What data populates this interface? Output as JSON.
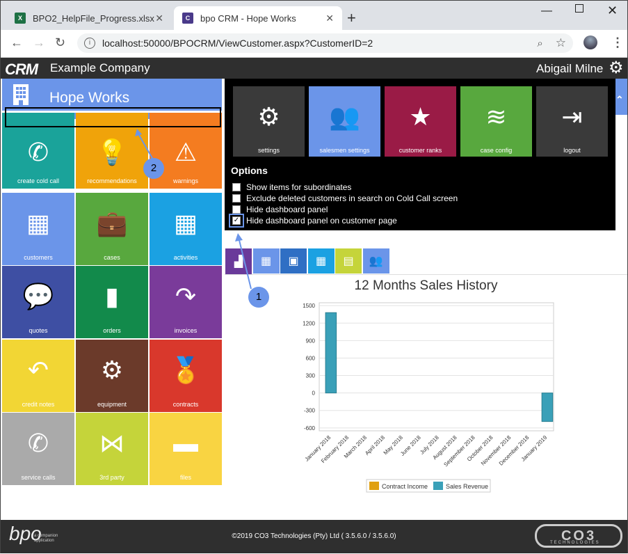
{
  "browser": {
    "tabs": [
      {
        "title": "BPO2_HelpFile_Progress.xlsx",
        "icon": "excel-icon",
        "active": false
      },
      {
        "title": "bpo CRM - Hope Works",
        "icon": "crm-icon",
        "active": true
      }
    ],
    "url_host": "localhost:50000/BPOCRM/ViewCustomer.aspx?CustomerID=2",
    "url_path": ""
  },
  "app": {
    "logo": "CRM",
    "company": "Example Company",
    "user": "Abigail Milne"
  },
  "customer": {
    "name": "Hope Works"
  },
  "tiles": [
    {
      "label": "create cold call",
      "icon": "phone-icon",
      "color": "#1aa39a"
    },
    {
      "label": "recommendations",
      "icon": "lightbulb-icon",
      "color": "#f0a30a"
    },
    {
      "label": "warnings",
      "icon": "warning-icon",
      "color": "#f47c20"
    },
    {
      "label": "customers",
      "icon": "building-icon",
      "color": "#6b95e9"
    },
    {
      "label": "cases",
      "icon": "briefcase-icon",
      "color": "#58a83e"
    },
    {
      "label": "activities",
      "icon": "calendar-icon",
      "color": "#1ba1e2"
    },
    {
      "label": "quotes",
      "icon": "chat-icon",
      "color": "#3e4fa3"
    },
    {
      "label": "orders",
      "icon": "book-icon",
      "color": "#128a4b"
    },
    {
      "label": "invoices",
      "icon": "redo-icon",
      "color": "#7a3b9a"
    },
    {
      "label": "credit notes",
      "icon": "undo-icon",
      "color": "#f2d634"
    },
    {
      "label": "equipment",
      "icon": "gears-icon",
      "color": "#6b3a2a"
    },
    {
      "label": "contracts",
      "icon": "award-icon",
      "color": "#d9382c"
    },
    {
      "label": "service calls",
      "icon": "phone-icon",
      "color": "#aaaaaa"
    },
    {
      "label": "3rd party",
      "icon": "share-icon",
      "color": "#c5d43a"
    },
    {
      "label": "files",
      "icon": "folder-icon",
      "color": "#f9d442"
    }
  ],
  "dropdown": {
    "tiles": [
      {
        "label": "settings",
        "icon": "gear-icon",
        "color": "#3a3a3a"
      },
      {
        "label": "salesmen settings",
        "icon": "users-icon",
        "color": "#6b95e9"
      },
      {
        "label": "customer ranks",
        "icon": "star-icon",
        "color": "#9a1b46"
      },
      {
        "label": "case config",
        "icon": "layers-icon",
        "color": "#58a83e"
      },
      {
        "label": "logout",
        "icon": "logout-icon",
        "color": "#3a3a3a"
      }
    ],
    "options_title": "Options",
    "options": [
      {
        "label": "Show items for subordinates",
        "checked": false
      },
      {
        "label": "Exclude deleted customers in search on Cold Call screen",
        "checked": false
      },
      {
        "label": "Hide dashboard panel",
        "checked": false
      },
      {
        "label": "Hide dashboard panel on customer page",
        "checked": true
      }
    ]
  },
  "icon_tabs": [
    {
      "icon": "chart-icon",
      "color": "#6a3a9a"
    },
    {
      "icon": "building-icon",
      "color": "#6b95e9"
    },
    {
      "icon": "contacts-icon",
      "color": "#2f6fc4"
    },
    {
      "icon": "calendar-icon",
      "color": "#1ba1e2"
    },
    {
      "icon": "document-icon",
      "color": "#c5d43a"
    },
    {
      "icon": "users-icon",
      "color": "#6b95e9"
    }
  ],
  "annotations": [
    "1",
    "2"
  ],
  "chart_data": {
    "type": "bar",
    "title": "12 Months Sales History",
    "categories": [
      "January 2018",
      "February 2018",
      "March 2018",
      "April 2018",
      "May 2018",
      "June 2018",
      "July 2018",
      "August 2018",
      "September 2018",
      "October 2018",
      "November 2018",
      "December 2018",
      "January 2019"
    ],
    "series": [
      {
        "name": "Contract Income",
        "color": "#e0a010",
        "values": [
          0,
          0,
          0,
          0,
          0,
          0,
          0,
          0,
          0,
          0,
          0,
          0,
          0
        ]
      },
      {
        "name": "Sales Revenue",
        "color": "#3aa0b8",
        "values": [
          1380,
          0,
          0,
          0,
          0,
          0,
          0,
          0,
          0,
          0,
          0,
          0,
          -490
        ]
      }
    ],
    "yticks": [
      1500,
      1200,
      900,
      600,
      300,
      0,
      -300,
      -600
    ],
    "ylim": [
      -650,
      1550
    ],
    "legend": "bottom",
    "grid": true
  },
  "footer": {
    "copyright": "©2019 CO3 Technologies (Pty) Ltd ( 3.5.6.0 / 3.5.6.0)",
    "bpo_logo": "bpo",
    "bpo_tag": "a companion application",
    "co3_logo": "CO3",
    "co3_tag": "TECHNOLOGIES"
  }
}
